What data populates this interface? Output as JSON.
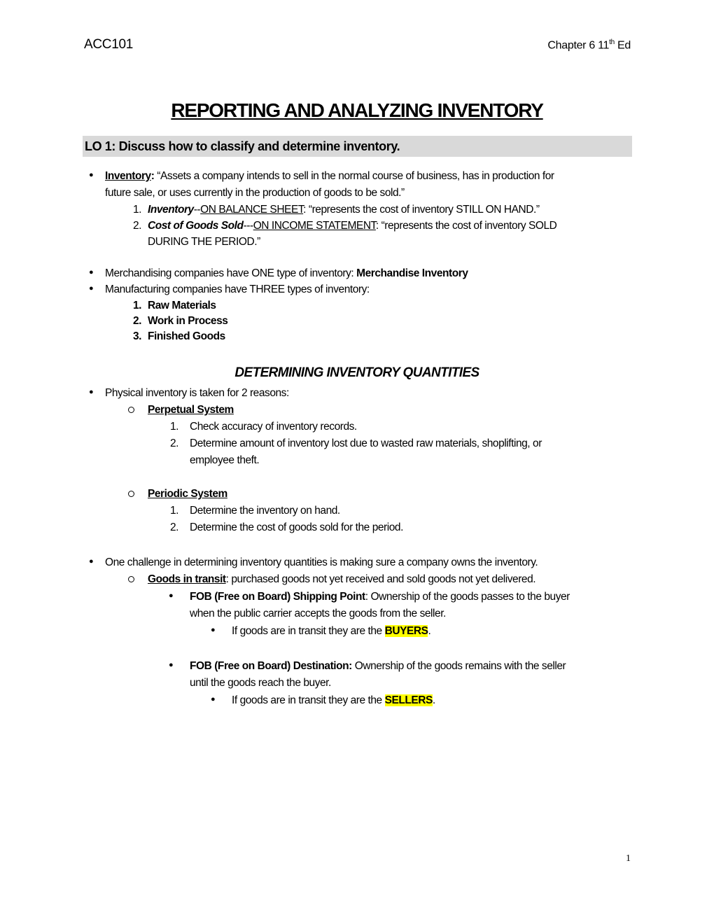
{
  "header": {
    "course": "ACC101",
    "chapter_prefix": "Chapter 6 11",
    "chapter_sup": "th",
    "chapter_suffix": " Ed"
  },
  "title": "REPORTING AND ANALYZING INVENTORY",
  "lo_banner": "LO 1:  Discuss how to classify and determine inventory.",
  "inventory_def": {
    "term": "Inventory",
    "colon": ":",
    "line1": "  “Assets a company intends to sell in the normal course of business, has in production for",
    "line2": "future sale, or uses currently in the production of goods to be sold.”",
    "items": [
      {
        "num": "1.",
        "term": "Inventory",
        "sep": "--",
        "statement": "ON BALANCE SHEET",
        "text": ": “represents the cost of inventory STILL ON HAND.”"
      },
      {
        "num": "2.",
        "term": "Cost of Goods Sold",
        "sep": "---",
        "statement": "ON INCOME STATEMENT",
        "text": ": “represents the cost of inventory SOLD",
        "text2": "DURING THE PERIOD.”"
      }
    ]
  },
  "merch": {
    "text": "Merchandising companies have ONE type of inventory:  ",
    "bold": "Merchandise Inventory"
  },
  "manuf": {
    "text": "Manufacturing companies have THREE types of inventory:",
    "items": [
      {
        "num": "1.",
        "label": "Raw Materials"
      },
      {
        "num": "2.",
        "label": "Work in Process"
      },
      {
        "num": "3.",
        "label": "Finished Goods"
      }
    ]
  },
  "section2_title": "DETERMINING INVENTORY QUANTITIES",
  "physical": {
    "text": "Physical inventory is taken for 2 reasons:",
    "perpetual": {
      "label": "Perpetual System",
      "items": [
        {
          "num": "1.",
          "text": "Check accuracy of inventory records."
        },
        {
          "num": "2.",
          "text": "Determine amount of inventory lost due to wasted raw materials, shoplifting, or",
          "text2": "employee theft."
        }
      ]
    },
    "periodic": {
      "label": "Periodic System",
      "items": [
        {
          "num": "1.",
          "text": "Determine the inventory on hand."
        },
        {
          "num": "2.",
          "text": "Determine the cost of goods sold for the period."
        }
      ]
    }
  },
  "challenge": {
    "text": "One challenge in determining inventory quantities is making sure a company owns the inventory.",
    "transit_label": "Goods in transit",
    "transit_text": ":  purchased goods not yet received and sold goods not yet delivered.",
    "fob_shipping": {
      "label": "FOB (Free on Board) Shipping Point",
      "text1": ":  Ownership of the goods passes to the buyer",
      "text2": "when the public carrier accepts the goods from the seller.",
      "sub_text": "If goods are in transit they are the ",
      "sub_hl": "BUYERS",
      "sub_end": "."
    },
    "fob_destination": {
      "label": "FOB (Free on Board) Destination:",
      "text1": "  Ownership of the goods remains with the seller",
      "text2": "until the goods reach the buyer.",
      "sub_text": "If goods are in transit they are the ",
      "sub_hl": "SELLERS",
      "sub_end": "."
    }
  },
  "page_number": "1",
  "colors": {
    "banner_bg": "#d9d9d9",
    "highlight": "#ffff00"
  }
}
